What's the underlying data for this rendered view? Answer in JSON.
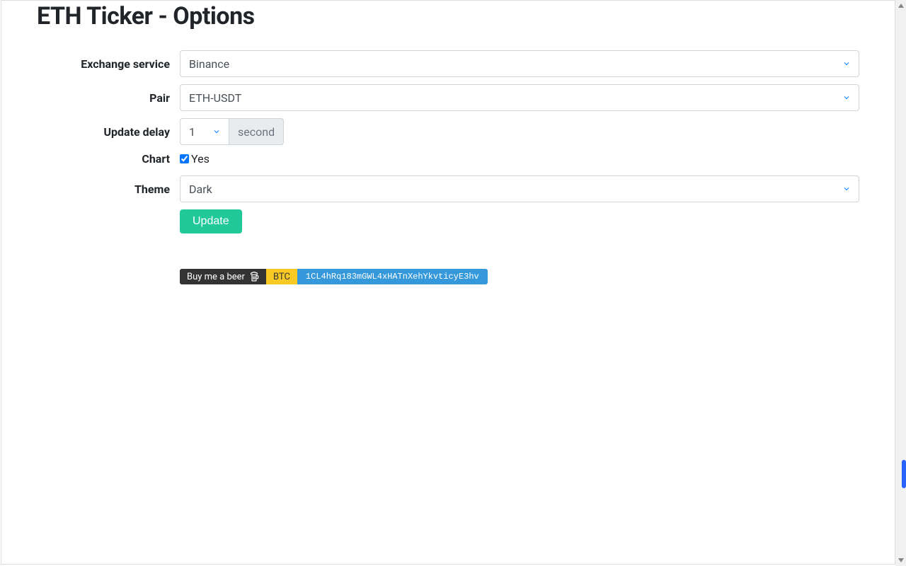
{
  "page_title": "ETH Ticker - Options",
  "labels": {
    "exchange_service": "Exchange service",
    "pair": "Pair",
    "update_delay": "Update delay",
    "chart": "Chart",
    "theme": "Theme"
  },
  "values": {
    "exchange_service": "Binance",
    "pair": "ETH-USDT",
    "update_delay": "1",
    "update_delay_unit": "second",
    "chart_checked": true,
    "chart_label": "Yes",
    "theme": "Dark"
  },
  "buttons": {
    "update": "Update"
  },
  "donation": {
    "beer_text": "Buy me a beer",
    "currency": "BTC",
    "address": "1CL4hRq183mGWL4xHATnXehYkvticyE3hv"
  }
}
